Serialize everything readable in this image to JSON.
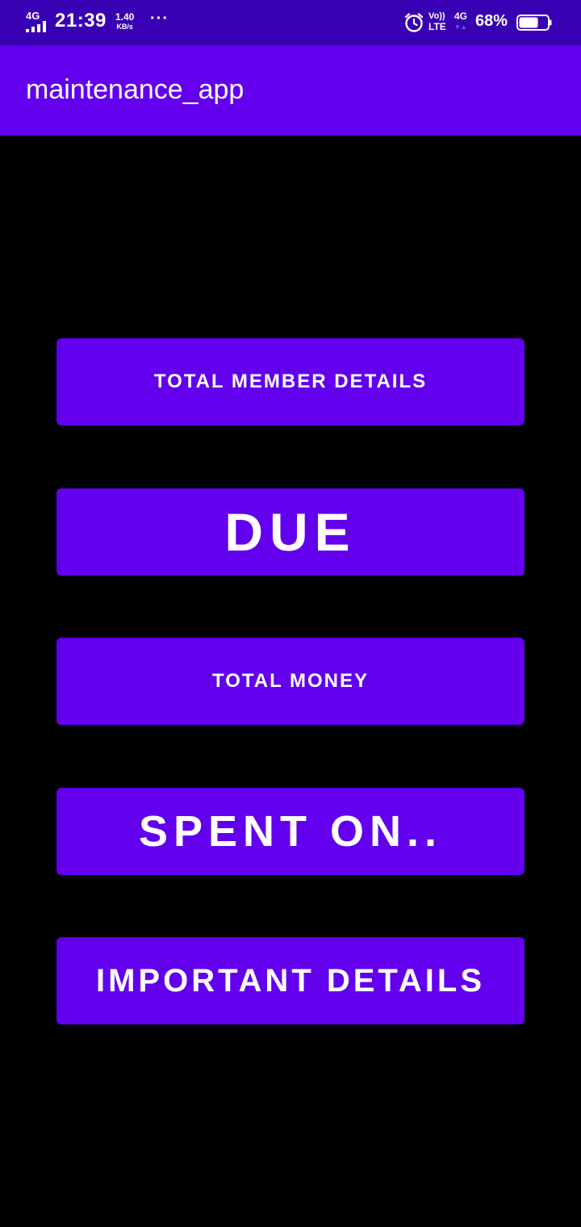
{
  "status_bar": {
    "network_type": "4G",
    "time": "21:39",
    "speed_value": "1.40",
    "speed_unit": "KB/s",
    "more": "···",
    "volte": "Vo))",
    "lte": "LTE",
    "network2": "4G",
    "network2_arrows": "▼▲",
    "battery_percent": "68%",
    "battery_level": 0.68,
    "icons": [
      "signal-icon",
      "more-icon",
      "alarm-icon",
      "battery-icon"
    ]
  },
  "app_bar": {
    "title": "maintenance_app"
  },
  "buttons": {
    "total_member_details": "TOTAL MEMBER DETAILS",
    "due": "DUE",
    "total_money": "TOTAL MONEY",
    "spent_on": "SPENT ON..",
    "important_details": "IMPORTANT DETAILS"
  },
  "colors": {
    "status_bar": "#3700B3",
    "primary": "#6200EE",
    "background": "#000000",
    "text": "#FFFFFF"
  }
}
